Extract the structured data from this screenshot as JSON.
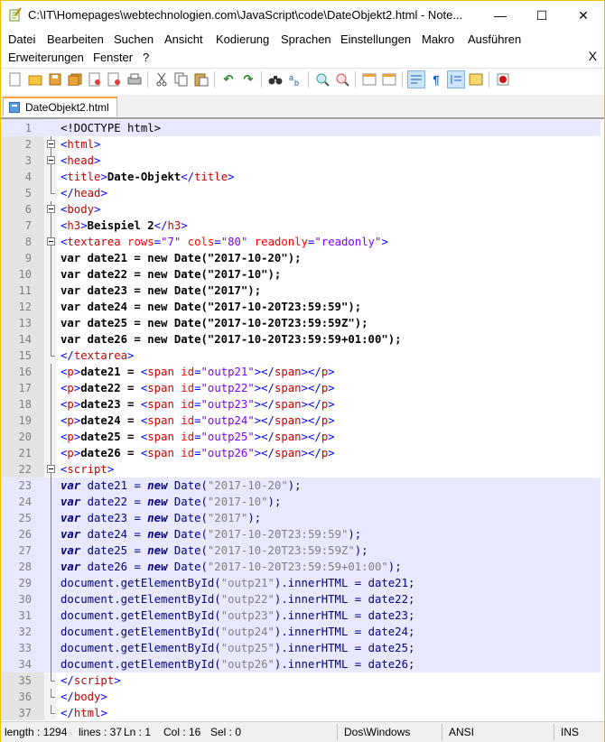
{
  "window": {
    "title": "C:\\IT\\Homepages\\webtechnologien.com\\JavaScript\\code\\DateObjekt2.html - Note...",
    "minimize": "—",
    "maximize": "☐",
    "close": "✕"
  },
  "menu": {
    "row1": [
      "Datei",
      "Bearbeiten",
      "Suchen",
      "Ansicht",
      "Kodierung",
      "Sprachen",
      "Einstellungen",
      "Makro",
      "Ausführen"
    ],
    "row2": [
      "Erweiterungen",
      "Fenster",
      "?"
    ],
    "close_doc": "X"
  },
  "toolbar": {
    "icons": [
      "new-file-icon",
      "open-file-icon",
      "save-icon",
      "save-all-icon",
      "close-icon",
      "close-all-icon",
      "print-icon",
      "cut-icon",
      "copy-icon",
      "paste-icon",
      "undo-icon",
      "redo-icon",
      "find-icon",
      "replace-icon",
      "zoom-in-icon",
      "zoom-out-icon",
      "sync-vertical-icon",
      "sync-horizontal-icon",
      "word-wrap-icon",
      "show-all-chars-icon",
      "indent-guide-icon",
      "language-icon",
      "record-macro-icon"
    ]
  },
  "tabs": [
    {
      "label": "DateObjekt2.html"
    }
  ],
  "editor": {
    "lines": [
      {
        "n": "1",
        "hl": true,
        "fold": "",
        "seg": [
          [
            "doct",
            "<!DOCTYPE html>"
          ]
        ]
      },
      {
        "n": "2",
        "fold": "open",
        "seg": [
          [
            "tag",
            "<"
          ],
          [
            "tn",
            "html"
          ],
          [
            "tag",
            ">"
          ]
        ]
      },
      {
        "n": "3",
        "fold": "open",
        "seg": [
          [
            "tag",
            "<"
          ],
          [
            "tn",
            "head"
          ],
          [
            "tag",
            ">"
          ]
        ]
      },
      {
        "n": "4",
        "fold": "line",
        "seg": [
          [
            "tag",
            "<"
          ],
          [
            "tn",
            "title"
          ],
          [
            "tag",
            ">"
          ],
          [
            "txt",
            "Date-Objekt"
          ],
          [
            "tag",
            "</"
          ],
          [
            "tn",
            "title"
          ],
          [
            "tag",
            ">"
          ]
        ]
      },
      {
        "n": "5",
        "fold": "end",
        "seg": [
          [
            "tag",
            "</"
          ],
          [
            "tn",
            "head"
          ],
          [
            "tag",
            ">"
          ]
        ]
      },
      {
        "n": "6",
        "fold": "open",
        "seg": [
          [
            "tag",
            "<"
          ],
          [
            "tn",
            "body"
          ],
          [
            "tag",
            ">"
          ]
        ]
      },
      {
        "n": "7",
        "fold": "line",
        "seg": [
          [
            "tag",
            "<"
          ],
          [
            "tn",
            "h3"
          ],
          [
            "tag",
            ">"
          ],
          [
            "txt",
            "Beispiel 2"
          ],
          [
            "tag",
            "</"
          ],
          [
            "tn",
            "h3"
          ],
          [
            "tag",
            ">"
          ]
        ]
      },
      {
        "n": "8",
        "fold": "open",
        "seg": [
          [
            "tag",
            "<"
          ],
          [
            "tn",
            "textarea"
          ],
          [
            "tag",
            " "
          ],
          [
            "attr",
            "rows"
          ],
          [
            "tag",
            "="
          ],
          [
            "val",
            "\"7\""
          ],
          [
            "tag",
            " "
          ],
          [
            "attr",
            "cols"
          ],
          [
            "tag",
            "="
          ],
          [
            "val",
            "\"80\""
          ],
          [
            "tag",
            " "
          ],
          [
            "attr",
            "readonly"
          ],
          [
            "tag",
            "="
          ],
          [
            "val",
            "\"readonly\""
          ],
          [
            "tag",
            ">"
          ]
        ]
      },
      {
        "n": "9",
        "fold": "line",
        "seg": [
          [
            "txt",
            "var date21 = new Date(\"2017-10-20\");"
          ]
        ]
      },
      {
        "n": "10",
        "fold": "line",
        "seg": [
          [
            "txt",
            "var date22 = new Date(\"2017-10\");"
          ]
        ]
      },
      {
        "n": "11",
        "fold": "line",
        "seg": [
          [
            "txt",
            "var date23 = new Date(\"2017\");"
          ]
        ]
      },
      {
        "n": "12",
        "fold": "line",
        "seg": [
          [
            "txt",
            "var date24 = new Date(\"2017-10-20T23:59:59\");"
          ]
        ]
      },
      {
        "n": "13",
        "fold": "line",
        "seg": [
          [
            "txt",
            "var date25 = new Date(\"2017-10-20T23:59:59Z\");"
          ]
        ]
      },
      {
        "n": "14",
        "fold": "line",
        "seg": [
          [
            "txt",
            "var date26 = new Date(\"2017-10-20T23:59:59+01:00\");"
          ]
        ]
      },
      {
        "n": "15",
        "fold": "end",
        "seg": [
          [
            "tag",
            "</"
          ],
          [
            "tn",
            "textarea"
          ],
          [
            "tag",
            ">"
          ]
        ]
      },
      {
        "n": "16",
        "fold": "line",
        "seg": [
          [
            "tag",
            "<"
          ],
          [
            "tn",
            "p"
          ],
          [
            "tag",
            ">"
          ],
          [
            "txt",
            "date21 = "
          ],
          [
            "tag",
            "<"
          ],
          [
            "tn",
            "span"
          ],
          [
            "tag",
            " "
          ],
          [
            "attr",
            "id"
          ],
          [
            "tag",
            "="
          ],
          [
            "val",
            "\"outp21\""
          ],
          [
            "tag",
            "></"
          ],
          [
            "tn",
            "span"
          ],
          [
            "tag",
            "></"
          ],
          [
            "tn",
            "p"
          ],
          [
            "tag",
            ">"
          ]
        ]
      },
      {
        "n": "17",
        "fold": "line",
        "seg": [
          [
            "tag",
            "<"
          ],
          [
            "tn",
            "p"
          ],
          [
            "tag",
            ">"
          ],
          [
            "txt",
            "date22 = "
          ],
          [
            "tag",
            "<"
          ],
          [
            "tn",
            "span"
          ],
          [
            "tag",
            " "
          ],
          [
            "attr",
            "id"
          ],
          [
            "tag",
            "="
          ],
          [
            "val",
            "\"outp22\""
          ],
          [
            "tag",
            "></"
          ],
          [
            "tn",
            "span"
          ],
          [
            "tag",
            "></"
          ],
          [
            "tn",
            "p"
          ],
          [
            "tag",
            ">"
          ]
        ]
      },
      {
        "n": "18",
        "fold": "line",
        "seg": [
          [
            "tag",
            "<"
          ],
          [
            "tn",
            "p"
          ],
          [
            "tag",
            ">"
          ],
          [
            "txt",
            "date23 = "
          ],
          [
            "tag",
            "<"
          ],
          [
            "tn",
            "span"
          ],
          [
            "tag",
            " "
          ],
          [
            "attr",
            "id"
          ],
          [
            "tag",
            "="
          ],
          [
            "val",
            "\"outp23\""
          ],
          [
            "tag",
            "></"
          ],
          [
            "tn",
            "span"
          ],
          [
            "tag",
            "></"
          ],
          [
            "tn",
            "p"
          ],
          [
            "tag",
            ">"
          ]
        ]
      },
      {
        "n": "19",
        "fold": "line",
        "seg": [
          [
            "tag",
            "<"
          ],
          [
            "tn",
            "p"
          ],
          [
            "tag",
            ">"
          ],
          [
            "txt",
            "date24 = "
          ],
          [
            "tag",
            "<"
          ],
          [
            "tn",
            "span"
          ],
          [
            "tag",
            " "
          ],
          [
            "attr",
            "id"
          ],
          [
            "tag",
            "="
          ],
          [
            "val",
            "\"outp24\""
          ],
          [
            "tag",
            "></"
          ],
          [
            "tn",
            "span"
          ],
          [
            "tag",
            "></"
          ],
          [
            "tn",
            "p"
          ],
          [
            "tag",
            ">"
          ]
        ]
      },
      {
        "n": "20",
        "fold": "line",
        "seg": [
          [
            "tag",
            "<"
          ],
          [
            "tn",
            "p"
          ],
          [
            "tag",
            ">"
          ],
          [
            "txt",
            "date25 = "
          ],
          [
            "tag",
            "<"
          ],
          [
            "tn",
            "span"
          ],
          [
            "tag",
            " "
          ],
          [
            "attr",
            "id"
          ],
          [
            "tag",
            "="
          ],
          [
            "val",
            "\"outp25\""
          ],
          [
            "tag",
            "></"
          ],
          [
            "tn",
            "span"
          ],
          [
            "tag",
            "></"
          ],
          [
            "tn",
            "p"
          ],
          [
            "tag",
            ">"
          ]
        ]
      },
      {
        "n": "21",
        "fold": "line",
        "seg": [
          [
            "tag",
            "<"
          ],
          [
            "tn",
            "p"
          ],
          [
            "tag",
            ">"
          ],
          [
            "txt",
            "date26 = "
          ],
          [
            "tag",
            "<"
          ],
          [
            "tn",
            "span"
          ],
          [
            "tag",
            " "
          ],
          [
            "attr",
            "id"
          ],
          [
            "tag",
            "="
          ],
          [
            "val",
            "\"outp26\""
          ],
          [
            "tag",
            "></"
          ],
          [
            "tn",
            "span"
          ],
          [
            "tag",
            "></"
          ],
          [
            "tn",
            "p"
          ],
          [
            "tag",
            ">"
          ]
        ]
      },
      {
        "n": "22",
        "fold": "open",
        "seg": [
          [
            "tag",
            "<"
          ],
          [
            "tn",
            "script"
          ],
          [
            "tag",
            ">"
          ]
        ]
      },
      {
        "n": "23",
        "hl": true,
        "fold": "line",
        "seg": [
          [
            "kw",
            "var"
          ],
          [
            "js",
            " date21 = "
          ],
          [
            "kw",
            "new"
          ],
          [
            "js",
            " Date("
          ],
          [
            "str",
            "\"2017-10-20\""
          ],
          [
            "js",
            ");"
          ]
        ]
      },
      {
        "n": "24",
        "hl": true,
        "fold": "line",
        "seg": [
          [
            "kw",
            "var"
          ],
          [
            "js",
            " date22 = "
          ],
          [
            "kw",
            "new"
          ],
          [
            "js",
            " Date("
          ],
          [
            "str",
            "\"2017-10\""
          ],
          [
            "js",
            ");"
          ]
        ]
      },
      {
        "n": "25",
        "hl": true,
        "fold": "line",
        "seg": [
          [
            "kw",
            "var"
          ],
          [
            "js",
            " date23 = "
          ],
          [
            "kw",
            "new"
          ],
          [
            "js",
            " Date("
          ],
          [
            "str",
            "\"2017\""
          ],
          [
            "js",
            ");"
          ]
        ]
      },
      {
        "n": "26",
        "hl": true,
        "fold": "line",
        "seg": [
          [
            "kw",
            "var"
          ],
          [
            "js",
            " date24 = "
          ],
          [
            "kw",
            "new"
          ],
          [
            "js",
            " Date("
          ],
          [
            "str",
            "\"2017-10-20T23:59:59\""
          ],
          [
            "js",
            ");"
          ]
        ]
      },
      {
        "n": "27",
        "hl": true,
        "fold": "line",
        "seg": [
          [
            "kw",
            "var"
          ],
          [
            "js",
            " date25 = "
          ],
          [
            "kw",
            "new"
          ],
          [
            "js",
            " Date("
          ],
          [
            "str",
            "\"2017-10-20T23:59:59Z\""
          ],
          [
            "js",
            ");"
          ]
        ]
      },
      {
        "n": "28",
        "hl": true,
        "fold": "line",
        "seg": [
          [
            "kw",
            "var"
          ],
          [
            "js",
            " date26 = "
          ],
          [
            "kw",
            "new"
          ],
          [
            "js",
            " Date("
          ],
          [
            "str",
            "\"2017-10-20T23:59:59+01:00\""
          ],
          [
            "js",
            ");"
          ]
        ]
      },
      {
        "n": "29",
        "hl": true,
        "fold": "line",
        "seg": [
          [
            "js",
            "document.getElementById("
          ],
          [
            "str",
            "\"outp21\""
          ],
          [
            "js",
            ").innerHTML = date21;"
          ]
        ]
      },
      {
        "n": "30",
        "hl": true,
        "fold": "line",
        "seg": [
          [
            "js",
            "document.getElementById("
          ],
          [
            "str",
            "\"outp22\""
          ],
          [
            "js",
            ").innerHTML = date22;"
          ]
        ]
      },
      {
        "n": "31",
        "hl": true,
        "fold": "line",
        "seg": [
          [
            "js",
            "document.getElementById("
          ],
          [
            "str",
            "\"outp23\""
          ],
          [
            "js",
            ").innerHTML = date23;"
          ]
        ]
      },
      {
        "n": "32",
        "hl": true,
        "fold": "line",
        "seg": [
          [
            "js",
            "document.getElementById("
          ],
          [
            "str",
            "\"outp24\""
          ],
          [
            "js",
            ").innerHTML = date24;"
          ]
        ]
      },
      {
        "n": "33",
        "hl": true,
        "fold": "line",
        "seg": [
          [
            "js",
            "document.getElementById("
          ],
          [
            "str",
            "\"outp25\""
          ],
          [
            "js",
            ").innerHTML = date25;"
          ]
        ]
      },
      {
        "n": "34",
        "hl": true,
        "fold": "line",
        "seg": [
          [
            "js",
            "document.getElementById("
          ],
          [
            "str",
            "\"outp26\""
          ],
          [
            "js",
            ").innerHTML = date26;"
          ]
        ]
      },
      {
        "n": "35",
        "fold": "end",
        "seg": [
          [
            "tag",
            "</"
          ],
          [
            "tn",
            "script"
          ],
          [
            "tag",
            ">"
          ]
        ]
      },
      {
        "n": "36",
        "fold": "end",
        "seg": [
          [
            "tag",
            "</"
          ],
          [
            "tn",
            "body"
          ],
          [
            "tag",
            ">"
          ]
        ]
      },
      {
        "n": "37",
        "fold": "end",
        "seg": [
          [
            "tag",
            "</"
          ],
          [
            "tn",
            "html"
          ],
          [
            "tag",
            ">"
          ]
        ]
      }
    ]
  },
  "status": {
    "length": "length : 1294",
    "lines": "lines : 37",
    "ln": "Ln : 1",
    "col": "Col : 16",
    "sel": "Sel : 0",
    "eol": "Dos\\Windows",
    "encoding": "ANSI",
    "mode": "INS"
  }
}
